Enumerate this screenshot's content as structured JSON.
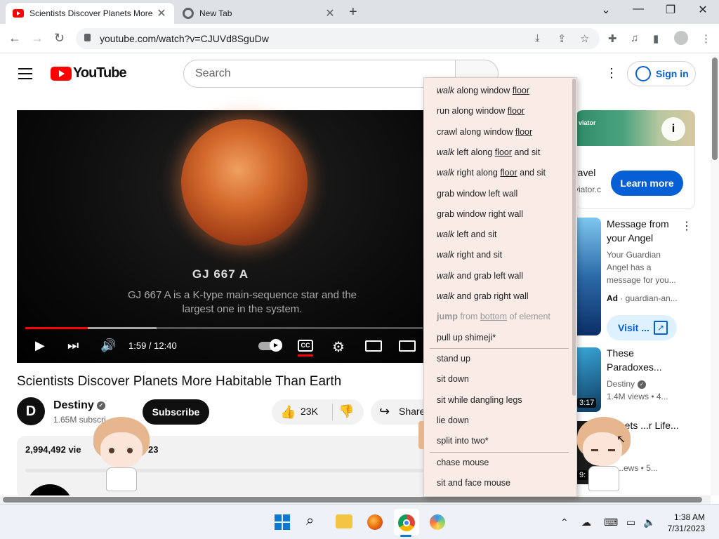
{
  "browser": {
    "tabs": [
      {
        "title": "Scientists Discover Planets More",
        "active": true
      },
      {
        "title": "New Tab",
        "active": false
      }
    ],
    "url": "youtube.com/watch?v=CJUVd8SguDw"
  },
  "youtube": {
    "logo_text": "YouTube",
    "search_placeholder": "Search",
    "sign_in": "Sign in"
  },
  "video": {
    "overlay_title": "GJ 667 A",
    "overlay_desc": "GJ 667 A is a K-type main-sequence star and the largest one in the system.",
    "time": "1:59 / 12:40",
    "cc_label": "CC",
    "progress_fraction": 0.157,
    "buffer_fraction": 0.33,
    "title": "Scientists Discover Planets More Habitable Than Earth",
    "channel": "Destiny",
    "subscribers": "1.65M subscri",
    "subscribe_label": "Subscribe",
    "likes": "23K",
    "share_label": "Share",
    "views": "2,994,492 vie",
    "views_tail": "23"
  },
  "sidebar": {
    "ad": {
      "banner_text": "viator",
      "title": "ravel",
      "domain": "viator.c",
      "cta": "Learn more"
    },
    "items": [
      {
        "title": "Message from your Angel",
        "desc": "Your Guardian Angel has a message for you...",
        "ad_label": "Ad",
        "sponsor": "guardian-an...",
        "cta": "Visit ..."
      },
      {
        "title": "These Paradoxes...",
        "channel": "Destiny",
        "meta": "1.4M views • 4...",
        "duration": "3:17"
      },
      {
        "title": "...ets ...r Life...",
        "meta": "...ews • 5...",
        "duration": "9:"
      }
    ]
  },
  "menu": {
    "items": [
      {
        "parts": [
          {
            "t": "walk",
            "s": "i"
          },
          {
            "t": " along window "
          },
          {
            "t": "floor",
            "s": "u"
          }
        ]
      },
      {
        "parts": [
          {
            "t": "run along window "
          },
          {
            "t": "floor",
            "s": "u"
          }
        ]
      },
      {
        "parts": [
          {
            "t": "crawl along window "
          },
          {
            "t": "floor",
            "s": "u"
          }
        ]
      },
      {
        "parts": [
          {
            "t": "walk",
            "s": "i"
          },
          {
            "t": " left along "
          },
          {
            "t": "floor",
            "s": "u"
          },
          {
            "t": " and sit"
          }
        ]
      },
      {
        "parts": [
          {
            "t": "walk",
            "s": "i"
          },
          {
            "t": " right along "
          },
          {
            "t": "floor",
            "s": "u"
          },
          {
            "t": " and sit"
          }
        ]
      },
      {
        "parts": [
          {
            "t": "grab window left wall"
          }
        ]
      },
      {
        "parts": [
          {
            "t": "grab window right wall"
          }
        ]
      },
      {
        "parts": [
          {
            "t": "walk",
            "s": "i"
          },
          {
            "t": " left and sit"
          }
        ]
      },
      {
        "parts": [
          {
            "t": "walk",
            "s": "i"
          },
          {
            "t": " right and sit"
          }
        ]
      },
      {
        "parts": [
          {
            "t": "walk",
            "s": "i"
          },
          {
            "t": " and grab left wall"
          }
        ]
      },
      {
        "parts": [
          {
            "t": "walk",
            "s": "i"
          },
          {
            "t": " and grab right wall"
          }
        ]
      },
      {
        "parts": [
          {
            "t": "jump",
            "s": "b"
          },
          {
            "t": " from "
          },
          {
            "t": "bottom",
            "s": "u"
          },
          {
            "t": " of element"
          }
        ],
        "disabled": true
      },
      {
        "parts": [
          {
            "t": "pull up shimeji*"
          }
        ]
      },
      {
        "parts": [
          {
            "t": "stand up"
          }
        ]
      },
      {
        "parts": [
          {
            "t": "sit down"
          }
        ]
      },
      {
        "parts": [
          {
            "t": "sit while dangling legs"
          }
        ]
      },
      {
        "parts": [
          {
            "t": "lie down"
          }
        ]
      },
      {
        "parts": [
          {
            "t": "split into two*"
          }
        ]
      },
      {
        "parts": [
          {
            "t": "chase mouse"
          }
        ]
      },
      {
        "parts": [
          {
            "t": "sit and face mouse"
          }
        ]
      }
    ]
  },
  "taskbar": {
    "time": "1:38 AM",
    "date": "7/31/2023"
  }
}
